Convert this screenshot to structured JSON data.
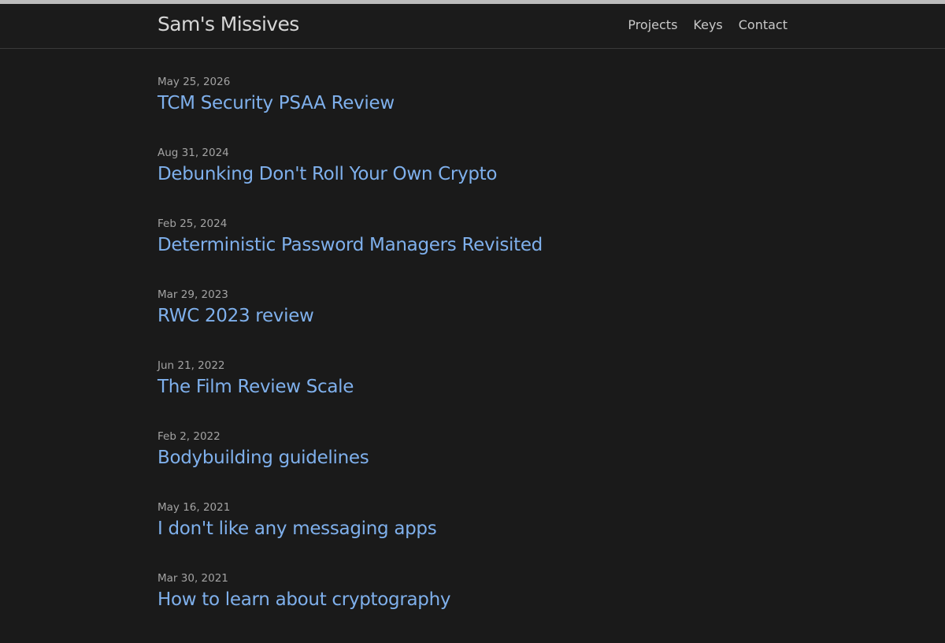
{
  "header": {
    "site_title": "Sam's Missives",
    "nav": [
      {
        "label": "Projects"
      },
      {
        "label": "Keys"
      },
      {
        "label": "Contact"
      }
    ]
  },
  "posts": [
    {
      "date": "May 25, 2026",
      "title": "TCM Security PSAA Review"
    },
    {
      "date": "Aug 31, 2024",
      "title": "Debunking Don't Roll Your Own Crypto"
    },
    {
      "date": "Feb 25, 2024",
      "title": "Deterministic Password Managers Revisited"
    },
    {
      "date": "Mar 29, 2023",
      "title": "RWC 2023 review"
    },
    {
      "date": "Jun 21, 2022",
      "title": "The Film Review Scale"
    },
    {
      "date": "Feb 2, 2022",
      "title": "Bodybuilding guidelines"
    },
    {
      "date": "May 16, 2021",
      "title": "I don't like any messaging apps"
    },
    {
      "date": "Mar 30, 2021",
      "title": "How to learn about cryptography"
    }
  ],
  "colors": {
    "background": "#1a1a1a",
    "link": "#7fb0ec",
    "date": "#a3a3a3",
    "title": "#d6d6d6"
  }
}
